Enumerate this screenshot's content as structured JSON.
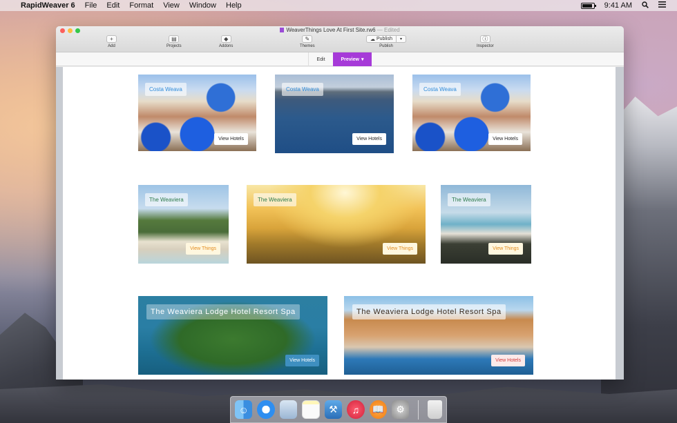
{
  "menubar": {
    "app_name": "RapidWeaver 6",
    "menus": [
      "File",
      "Edit",
      "Format",
      "View",
      "Window",
      "Help"
    ],
    "clock": "9:41 AM"
  },
  "window": {
    "title": "WeaverThings Love At First Site.rw6",
    "status": "— Edited",
    "toolbar": {
      "add": "Add",
      "projects": "Projects",
      "addons": "Addons",
      "themes": "Themes",
      "publish_button": "Publish",
      "publish_label": "Publish",
      "inspector": "Inspector"
    },
    "modes": {
      "edit": "Edit",
      "preview": "Preview"
    }
  },
  "cards": {
    "row1": [
      {
        "label": "Costa Weava",
        "cta": "View Hotels"
      },
      {
        "label": "Costa Weava",
        "cta": "View Hotels"
      },
      {
        "label": "Costa Weava",
        "cta": "View Hotels"
      }
    ],
    "row2": [
      {
        "label": "The Weaviera",
        "cta": "View Things"
      },
      {
        "label": "The Weaviera",
        "cta": "View Things"
      },
      {
        "label": "The Weaviera",
        "cta": "View Things"
      }
    ],
    "row3": [
      {
        "label": "The Weaviera Lodge Hotel Resort Spa",
        "cta": "View Hotels"
      },
      {
        "label": "The Weaviera Lodge Hotel Resort Spa",
        "cta": "View Hotels"
      }
    ]
  },
  "colors": {
    "accent": "#a63ad8",
    "label_blue": "#2e8ad8",
    "label_green": "#2c7a4a",
    "cta_orange": "#e28a1c",
    "cta_red": "#d23a3a"
  },
  "dock": [
    "finder-icon",
    "safari-icon",
    "preview-icon",
    "notes-icon",
    "xcode-icon",
    "itunes-icon",
    "ibooks-icon",
    "system-preferences-icon",
    "trash-icon"
  ]
}
